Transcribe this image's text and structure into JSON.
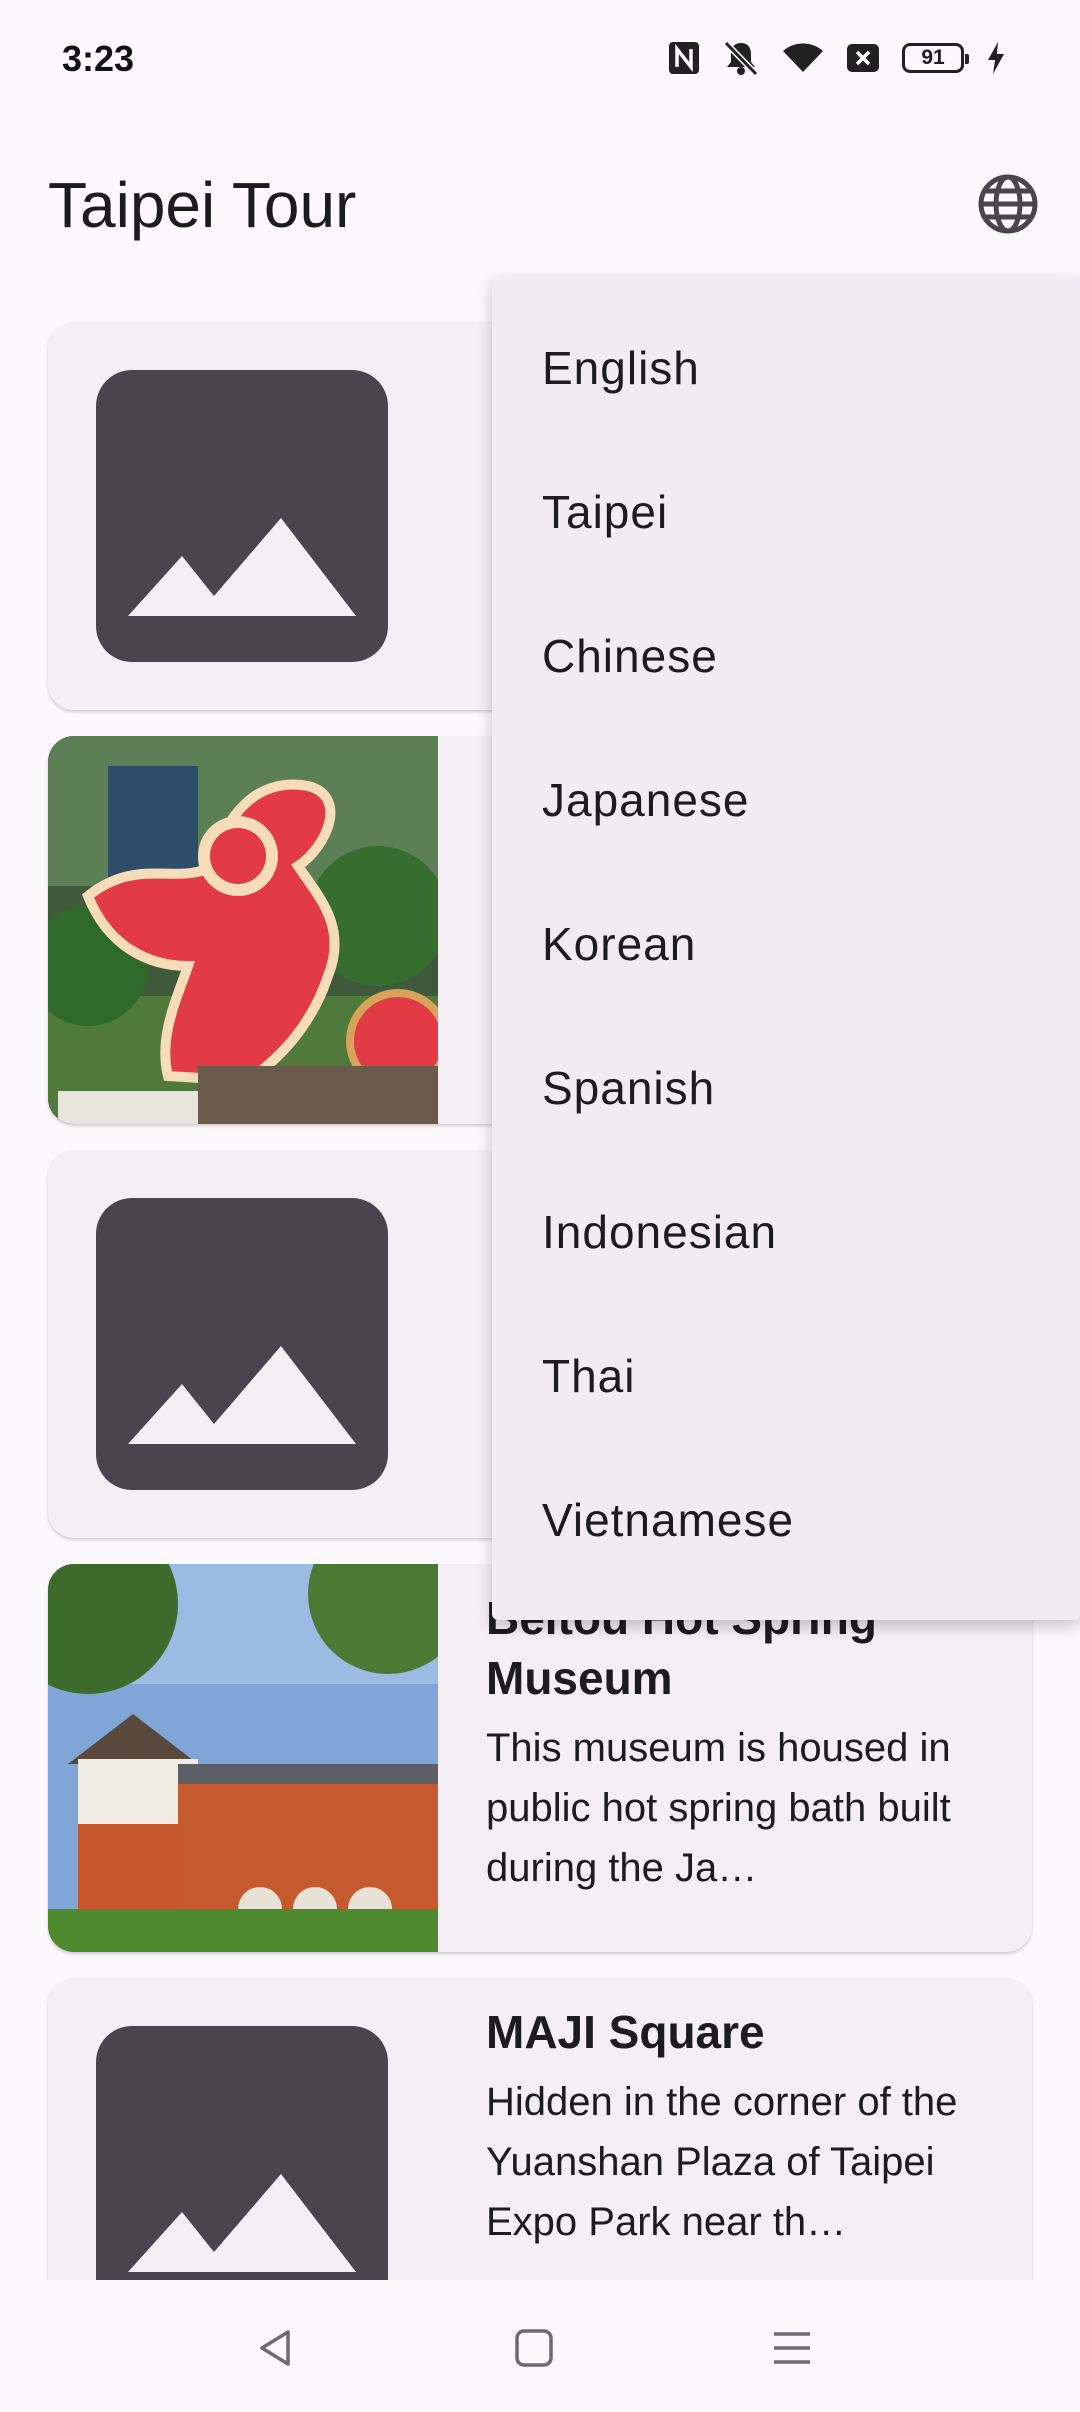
{
  "status_bar": {
    "time": "3:23",
    "battery_level": "91",
    "icons": [
      "nfc-icon",
      "mute-icon",
      "wifi-icon",
      "close-box-icon",
      "battery-icon",
      "charging-icon"
    ]
  },
  "app_bar": {
    "title": "Taipei Tour",
    "language_icon": "globe-icon"
  },
  "attractions": [
    {
      "title": "",
      "description": "",
      "image": "placeholder"
    },
    {
      "title": "",
      "description": "",
      "image": "photo-lantern-dragon"
    },
    {
      "title": "",
      "description": "",
      "image": "placeholder"
    },
    {
      "title": "Beitou Hot Spring Museum",
      "description": "This museum is housed in public hot spring bath built during the Ja…",
      "image": "photo-museum"
    },
    {
      "title": "MAJI Square",
      "description": "Hidden in the corner of the Yuanshan Plaza of Taipei Expo Park near th…",
      "image": "placeholder"
    }
  ],
  "language_menu": {
    "items": [
      "English",
      "Taipei",
      "Chinese",
      "Japanese",
      "Korean",
      "Spanish",
      "Indonesian",
      "Thai",
      "Vietnamese"
    ]
  },
  "nav_bar": {
    "buttons": [
      "back-icon",
      "home-icon",
      "menu-icon"
    ]
  },
  "colors": {
    "background": "#fdf8fd",
    "card": "#f3eff5",
    "placeholder": "#49454f",
    "menu": "#f1ecf4",
    "text": "#1c1b1f"
  }
}
